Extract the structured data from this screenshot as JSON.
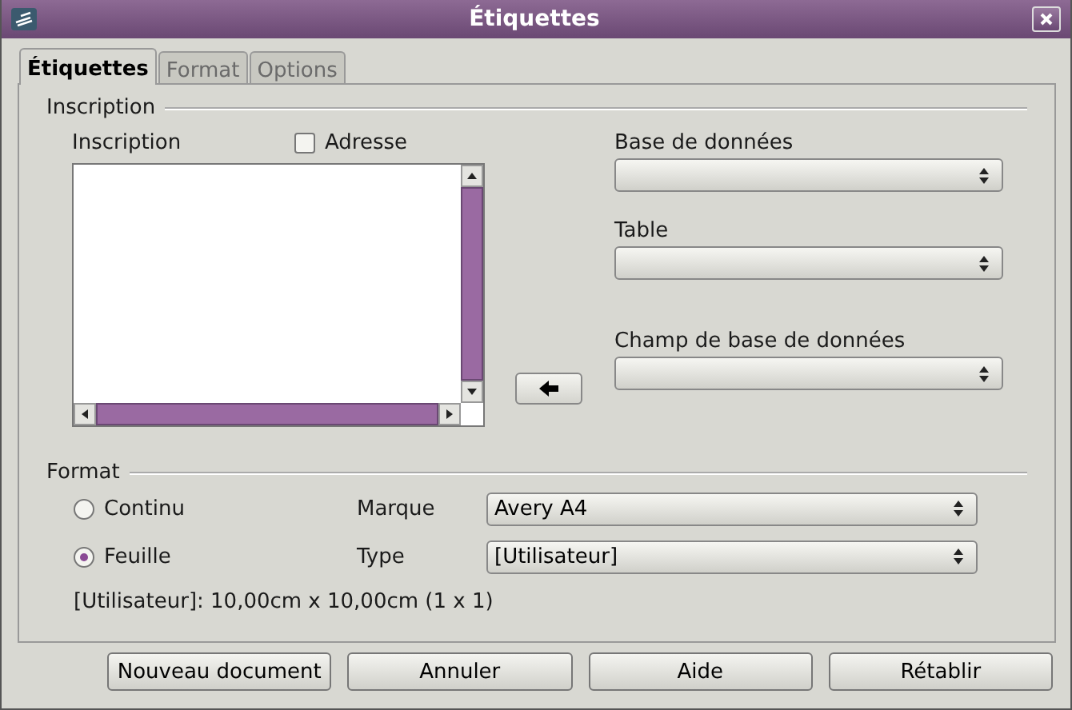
{
  "window": {
    "title": "Étiquettes"
  },
  "tabs": [
    {
      "label": "Étiquettes",
      "selected": true
    },
    {
      "label": "Format",
      "selected": false
    },
    {
      "label": "Options",
      "selected": false
    }
  ],
  "inscription": {
    "heading": "Inscription",
    "label": "Inscription",
    "address_checkbox": {
      "label": "Adresse",
      "checked": false
    },
    "database": {
      "label": "Base de données"
    },
    "table": {
      "label": "Table"
    },
    "database_field": {
      "label": "Champ de base de données"
    }
  },
  "format": {
    "heading": "Format",
    "options": [
      {
        "label": "Continu",
        "selected": false
      },
      {
        "label": "Feuille",
        "selected": true
      }
    ],
    "brand": {
      "label": "Marque",
      "value": "Avery A4"
    },
    "type": {
      "label": "Type",
      "value": "[Utilisateur]"
    },
    "summary": "[Utilisateur]: 10,00cm x 10,00cm (1 x 1)"
  },
  "buttons": [
    "Nouveau document",
    "Annuler",
    "Aide",
    "Rétablir"
  ]
}
